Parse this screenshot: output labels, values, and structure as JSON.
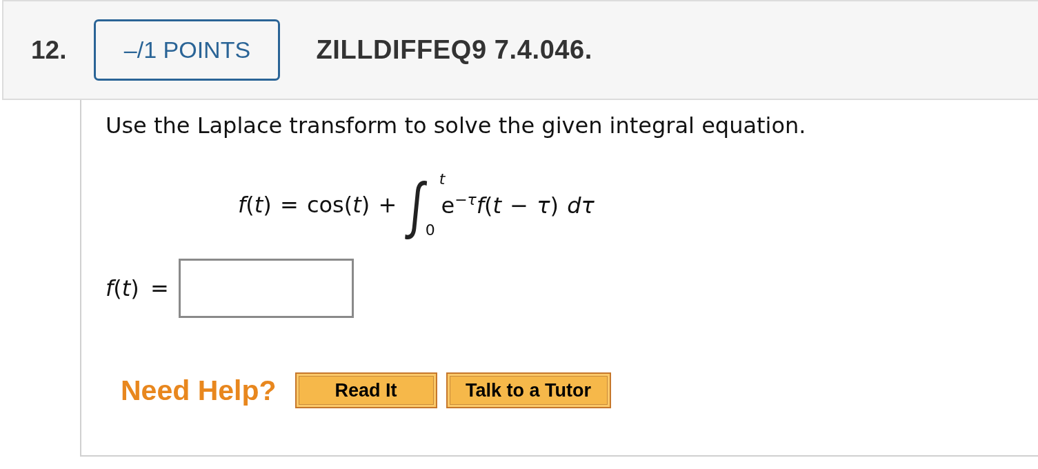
{
  "question": {
    "number": "12.",
    "points": "–/1 POINTS",
    "id": "ZILLDIFFEQ9 7.4.046."
  },
  "prompt": "Use the Laplace transform to solve the given integral equation.",
  "equation": {
    "lhs": "*f*(*t*) = cos(*t*) +",
    "integral_sign": "∫",
    "upper_limit": "t",
    "lower_limit": "0",
    "integrand": "e$^{−τ}$*f*(*t* − *τ*) *dτ*"
  },
  "answer": {
    "label": "*f*(*t*) ="
  },
  "help": {
    "label": "Need Help?",
    "buttons": [
      "Read It",
      "Talk to a Tutor"
    ]
  }
}
